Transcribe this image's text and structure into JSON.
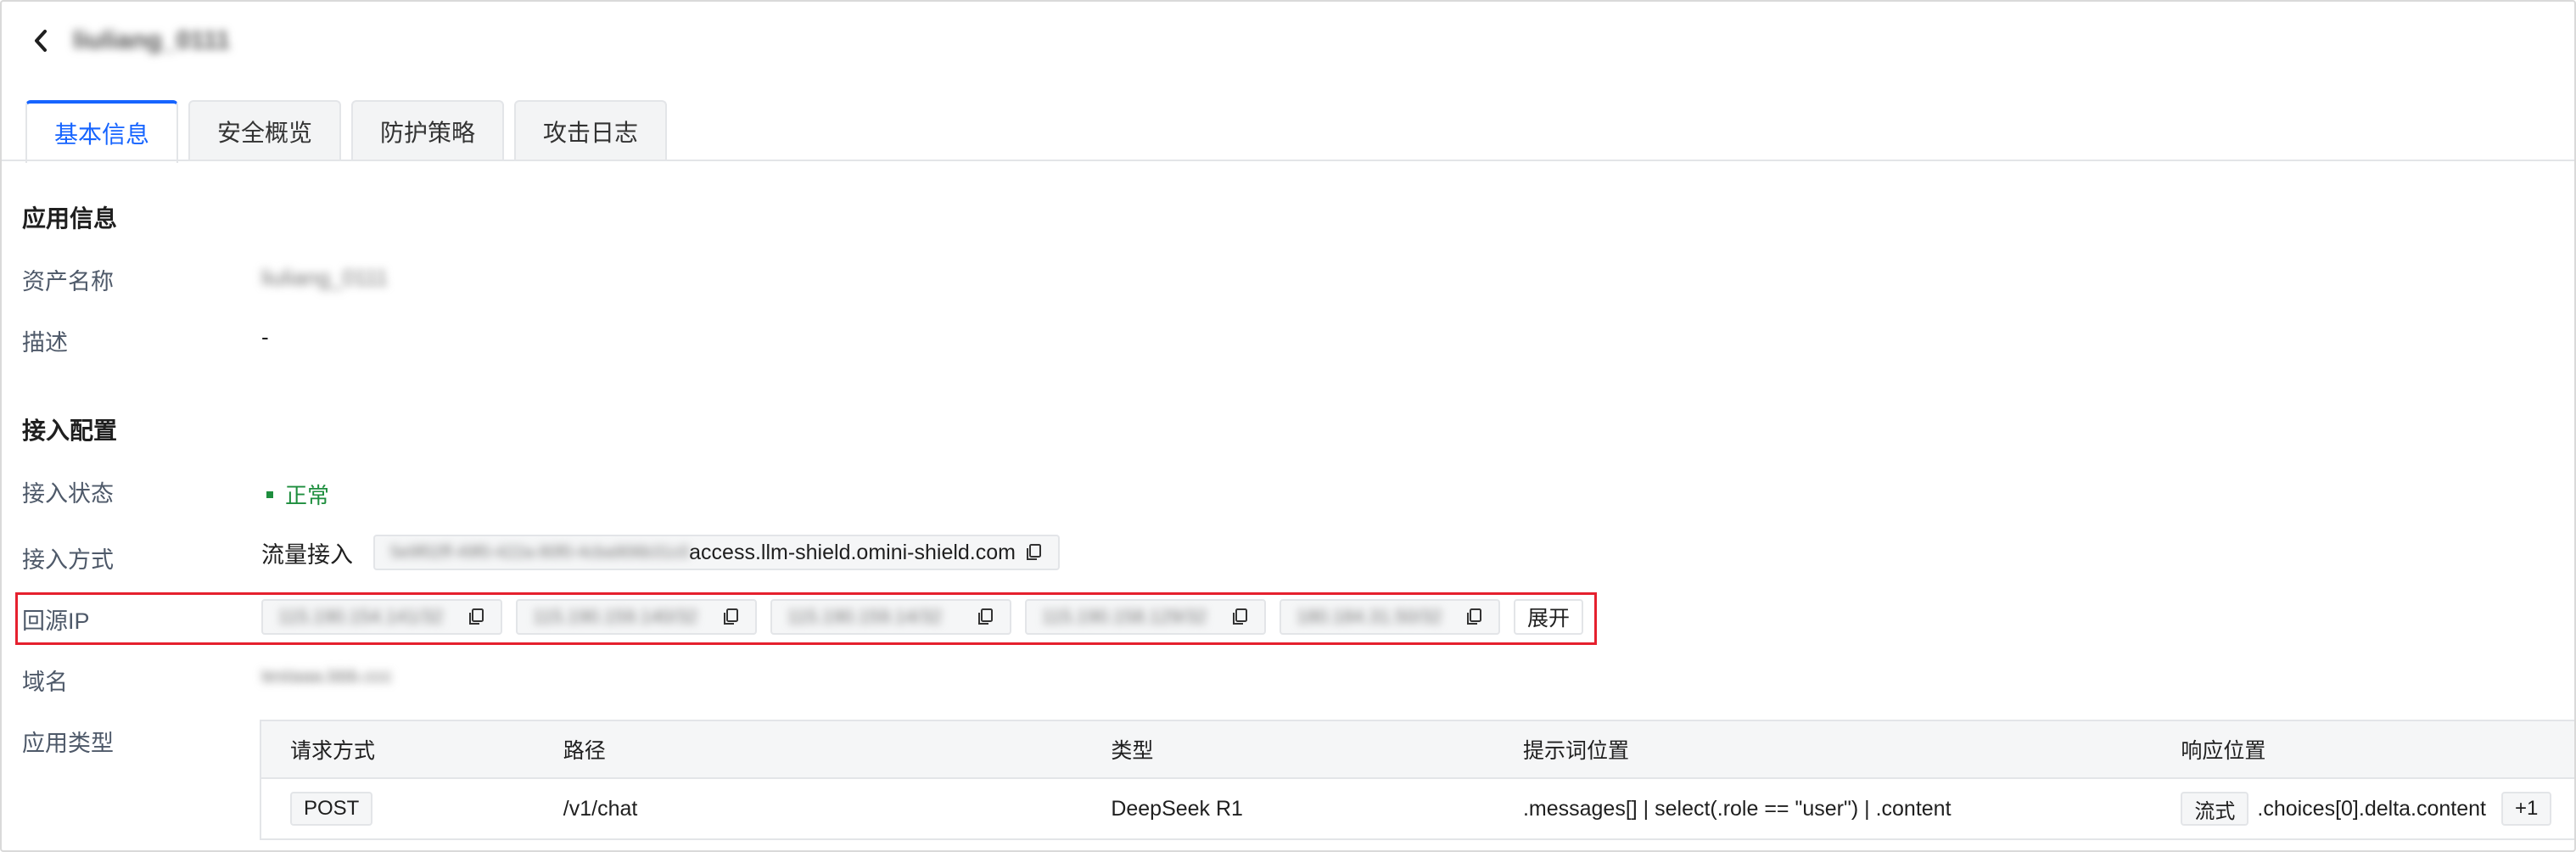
{
  "header": {
    "title": "liuliang_0111"
  },
  "tabs": [
    {
      "label": "基本信息"
    },
    {
      "label": "安全概览"
    },
    {
      "label": "防护策略"
    },
    {
      "label": "攻击日志"
    }
  ],
  "app_info": {
    "section_title": "应用信息",
    "asset_name_label": "资产名称",
    "asset_name_value": "liuliang_0111",
    "description_label": "描述",
    "description_value": "-"
  },
  "access_config": {
    "section_title": "接入配置",
    "status_label": "接入状态",
    "status_value": "正常",
    "method_label": "接入方式",
    "method_value": "流量接入",
    "access_prefix": "5e9f02ff-49f0-422a-80f0-4cba906b31c0",
    "access_domain": "access.llm-shield.omini-shield.com",
    "origin_ip_label": "回源IP",
    "origin_ips": [
      "115.190.154.141/32",
      "115.190.159.140/32",
      "115.190.159.14/32",
      "115.190.158.129/32",
      "180.184.31.50/32"
    ],
    "expand_label": "展开",
    "domain_label": "域名",
    "domain_value": "testaaa.bbb.ccc",
    "app_type_label": "应用类型"
  },
  "app_table": {
    "headers": [
      "请求方式",
      "路径",
      "类型",
      "提示词位置",
      "响应位置"
    ],
    "rows": [
      {
        "method": "POST",
        "path": "/v1/chat",
        "type": "DeepSeek R1",
        "prompt_location": ".messages[] | select(.role == \"user\") | .content",
        "response_mode": "流式",
        "response_location": ".choices[0].delta.content",
        "extra_count": "+1"
      }
    ]
  },
  "colors": {
    "accent": "#1664ff",
    "status_ok": "#1e8e3e",
    "highlight": "#e5202e"
  }
}
